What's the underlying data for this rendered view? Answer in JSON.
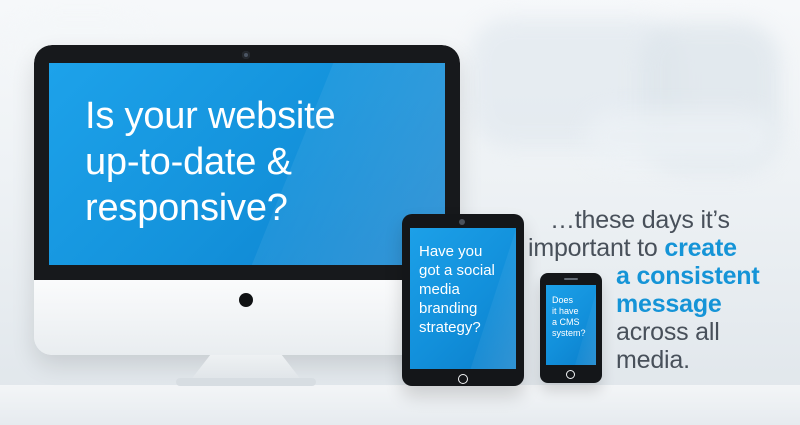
{
  "monitor": {
    "headline_lines": [
      "Is your website",
      "up-to-date &",
      "responsive?"
    ]
  },
  "tablet": {
    "question_lines": [
      "Have you",
      "got a social",
      "media",
      "branding",
      "strategy?"
    ]
  },
  "phone": {
    "question_lines": [
      "Does",
      "it have",
      "a CMS",
      "system?"
    ]
  },
  "message": {
    "line1": "…these days it’s",
    "line2_regular": "important to ",
    "line2_emphasis": "create",
    "line3_emphasis": "a consistent",
    "line4_emphasis": "message",
    "line5": "across all",
    "line6": "media."
  },
  "colors": {
    "screen_blue": "#1493dc",
    "accent_blue": "#1594d7",
    "text_gray": "#48505a",
    "device_black": "#141619"
  },
  "icons": {
    "monitor_camera": "camera-icon",
    "monitor_power": "power-icon",
    "tablet_home": "home-button-icon",
    "phone_home": "home-button-icon"
  }
}
